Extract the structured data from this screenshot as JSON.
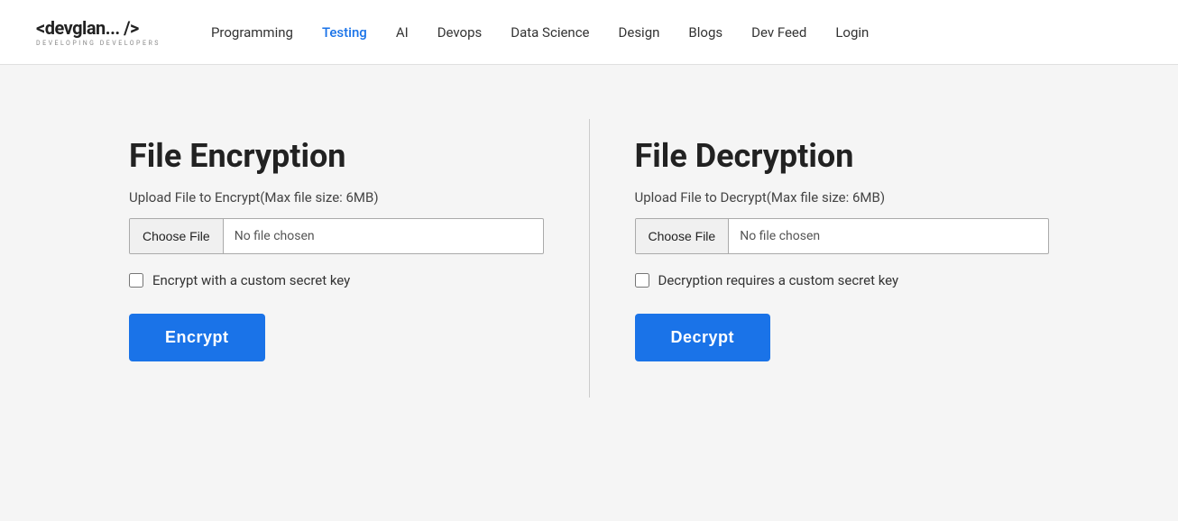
{
  "header": {
    "logo_main": "<devglan... />",
    "logo_sub": "DEVELOPING DEVELOPERS",
    "nav_items": [
      {
        "label": "Programming",
        "active": false
      },
      {
        "label": "Testing",
        "active": true
      },
      {
        "label": "AI",
        "active": false
      },
      {
        "label": "Devops",
        "active": false
      },
      {
        "label": "Data Science",
        "active": false
      },
      {
        "label": "Design",
        "active": false
      },
      {
        "label": "Blogs",
        "active": false
      },
      {
        "label": "Dev Feed",
        "active": false
      },
      {
        "label": "Login",
        "active": false
      }
    ]
  },
  "encrypt_panel": {
    "title": "File Encryption",
    "subtitle": "Upload File to Encrypt(Max file size: 6MB)",
    "choose_file_label": "Choose File",
    "no_file_label": "No file chosen",
    "checkbox_label": "Encrypt with a custom secret key",
    "button_label": "Encrypt"
  },
  "decrypt_panel": {
    "title": "File Decryption",
    "subtitle": "Upload File to Decrypt(Max file size: 6MB)",
    "choose_file_label": "Choose File",
    "no_file_label": "No file chosen",
    "checkbox_label": "Decryption requires a custom secret key",
    "button_label": "Decrypt"
  },
  "colors": {
    "accent": "#1a73e8"
  }
}
